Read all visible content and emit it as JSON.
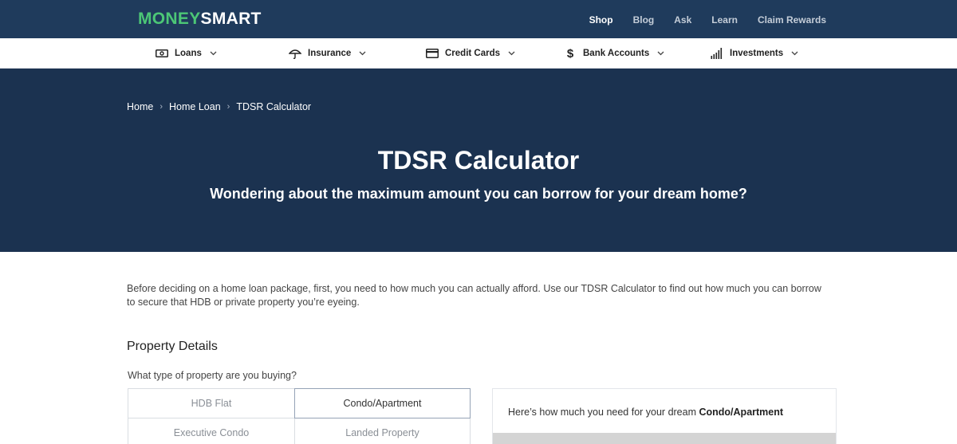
{
  "logo": {
    "part1": "MONEY",
    "part2": "SMART"
  },
  "top_nav": [
    {
      "label": "Shop",
      "active": true
    },
    {
      "label": "Blog",
      "active": false
    },
    {
      "label": "Ask",
      "active": false
    },
    {
      "label": "Learn",
      "active": false
    },
    {
      "label": "Claim Rewards",
      "active": false
    }
  ],
  "categories": [
    {
      "label": "Loans",
      "icon": "banknote-icon"
    },
    {
      "label": "Insurance",
      "icon": "umbrella-icon"
    },
    {
      "label": "Credit Cards",
      "icon": "credit-card-icon"
    },
    {
      "label": "Bank Accounts",
      "icon": "dollar-icon"
    },
    {
      "label": "Investments",
      "icon": "bar-signal-icon"
    }
  ],
  "breadcrumb": [
    "Home",
    "Home Loan",
    "TDSR Calculator"
  ],
  "hero": {
    "title": "TDSR Calculator",
    "subtitle": "Wondering about the maximum amount you can borrow for your dream home?"
  },
  "intro": "Before deciding on a home loan package, first, you need to how much you can actually afford. Use our TDSR Calculator to find out how much you can borrow to secure that HDB or private property you’re eyeing.",
  "property": {
    "section_title": "Property Details",
    "question": "What type of property are you buying?",
    "options": [
      "HDB Flat",
      "Condo/Apartment",
      "Executive Condo",
      "Landed Property"
    ],
    "selected": "Condo/Apartment"
  },
  "result": {
    "prefix": "Here’s how much you need for your dream ",
    "property": "Condo/Apartment"
  },
  "colors": {
    "topbar": "#1f3b5c",
    "hero": "#1b3250",
    "logo_green": "#4cc776"
  }
}
